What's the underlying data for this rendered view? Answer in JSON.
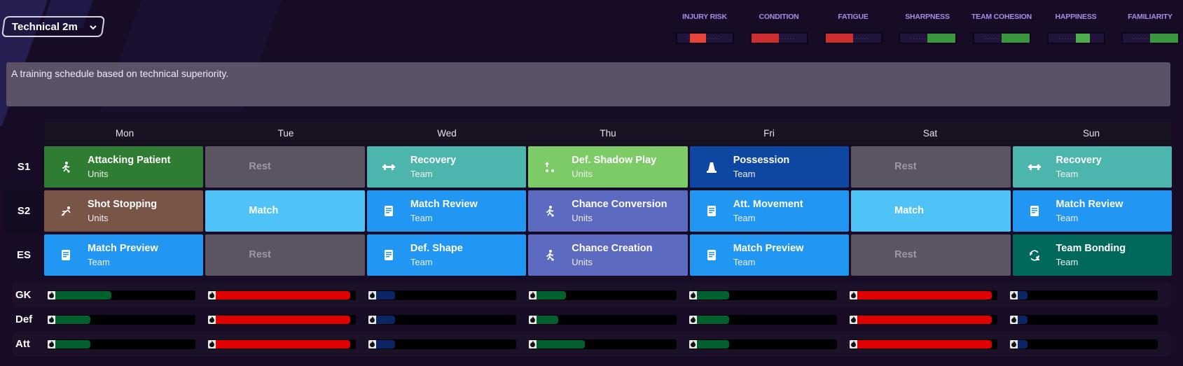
{
  "schedule_select": {
    "label": "Technical 2m"
  },
  "meters": [
    {
      "label": "INJURY RISK",
      "color": "#e8443a",
      "from": 0.23,
      "to": 0.52
    },
    {
      "label": "CONDITION",
      "color": "#cf2e2e",
      "from": 0.0,
      "to": 0.5
    },
    {
      "label": "FATIGUE",
      "color": "#cf2e2e",
      "from": 0.0,
      "to": 0.5
    },
    {
      "label": "SHARPNESS",
      "color": "#3a973e",
      "from": 0.5,
      "to": 1.0
    },
    {
      "label": "TEAM COHESION",
      "color": "#3a973e",
      "from": 0.5,
      "to": 1.0
    },
    {
      "label": "HAPPINESS",
      "color": "#4cae4c",
      "from": 0.5,
      "to": 0.75
    },
    {
      "label": "FAMILIARITY",
      "color": "#3a973e",
      "from": 0.5,
      "to": 1.0
    }
  ],
  "description": "A training schedule based on technical superiority.",
  "days": [
    "Mon",
    "Tue",
    "Wed",
    "Thu",
    "Fri",
    "Sat",
    "Sun"
  ],
  "sessions": [
    {
      "label": "S1",
      "cells": [
        {
          "title": "Attacking Patient",
          "sub": "Units",
          "icon": "player-kick-icon",
          "color": "#2e7d32"
        },
        {
          "title": "Rest",
          "sub": "",
          "icon": "",
          "color": "#5a5463",
          "type": "rest"
        },
        {
          "title": "Recovery",
          "sub": "Team",
          "icon": "dumbbell-icon",
          "color": "#4db6ac"
        },
        {
          "title": "Def. Shadow Play",
          "sub": "Units",
          "icon": "shadow-play-icon",
          "color": "#7dcb66"
        },
        {
          "title": "Possession",
          "sub": "Team",
          "icon": "cone-icon",
          "color": "#0d47a1"
        },
        {
          "title": "Rest",
          "sub": "",
          "icon": "",
          "color": "#5a5463",
          "type": "rest"
        },
        {
          "title": "Recovery",
          "sub": "Team",
          "icon": "dumbbell-icon",
          "color": "#4db6ac"
        }
      ]
    },
    {
      "label": "S2",
      "cells": [
        {
          "title": "Shot Stopping",
          "sub": "Units",
          "icon": "goalkeeper-dive-icon",
          "color": "#795548"
        },
        {
          "title": "Match",
          "sub": "",
          "icon": "",
          "color": "#4fc3f7",
          "type": "plain"
        },
        {
          "title": "Match Review",
          "sub": "Team",
          "icon": "document-icon",
          "color": "#2196f3"
        },
        {
          "title": "Chance Conversion",
          "sub": "Units",
          "icon": "player-kick-icon",
          "color": "#5c6bc0"
        },
        {
          "title": "Att. Movement",
          "sub": "Team",
          "icon": "document-icon",
          "color": "#2196f3"
        },
        {
          "title": "Match",
          "sub": "",
          "icon": "",
          "color": "#4fc3f7",
          "type": "plain"
        },
        {
          "title": "Match Review",
          "sub": "Team",
          "icon": "document-icon",
          "color": "#2196f3"
        }
      ]
    },
    {
      "label": "ES",
      "cells": [
        {
          "title": "Match Preview",
          "sub": "Team",
          "icon": "document-icon",
          "color": "#2196f3"
        },
        {
          "title": "Rest",
          "sub": "",
          "icon": "",
          "color": "#5a5463",
          "type": "rest"
        },
        {
          "title": "Def. Shape",
          "sub": "Team",
          "icon": "document-icon",
          "color": "#2196f3"
        },
        {
          "title": "Chance Creation",
          "sub": "Units",
          "icon": "player-kick-icon",
          "color": "#5c6bc0"
        },
        {
          "title": "Match Preview",
          "sub": "Team",
          "icon": "document-icon",
          "color": "#2196f3"
        },
        {
          "title": "Rest",
          "sub": "",
          "icon": "",
          "color": "#5a5463",
          "type": "rest"
        },
        {
          "title": "Team Bonding",
          "sub": "Team",
          "icon": "team-bonding-icon",
          "color": "#00695c"
        }
      ]
    }
  ],
  "load_colors": {
    "green": "#00612e",
    "red": "#e00000",
    "blue": "#0b2565"
  },
  "load_rows": [
    {
      "label": "GK",
      "values": [
        0.43,
        0.96,
        0.18,
        0.25,
        0.27,
        0.96,
        0.12
      ],
      "levels": [
        "green",
        "red",
        "blue",
        "green",
        "green",
        "red",
        "blue"
      ]
    },
    {
      "label": "Def",
      "values": [
        0.29,
        0.96,
        0.18,
        0.2,
        0.27,
        0.96,
        0.12
      ],
      "levels": [
        "green",
        "red",
        "blue",
        "green",
        "green",
        "red",
        "blue"
      ]
    },
    {
      "label": "Att",
      "values": [
        0.29,
        0.96,
        0.18,
        0.38,
        0.27,
        0.96,
        0.12
      ],
      "levels": [
        "green",
        "red",
        "blue",
        "green",
        "green",
        "red",
        "blue"
      ]
    }
  ]
}
